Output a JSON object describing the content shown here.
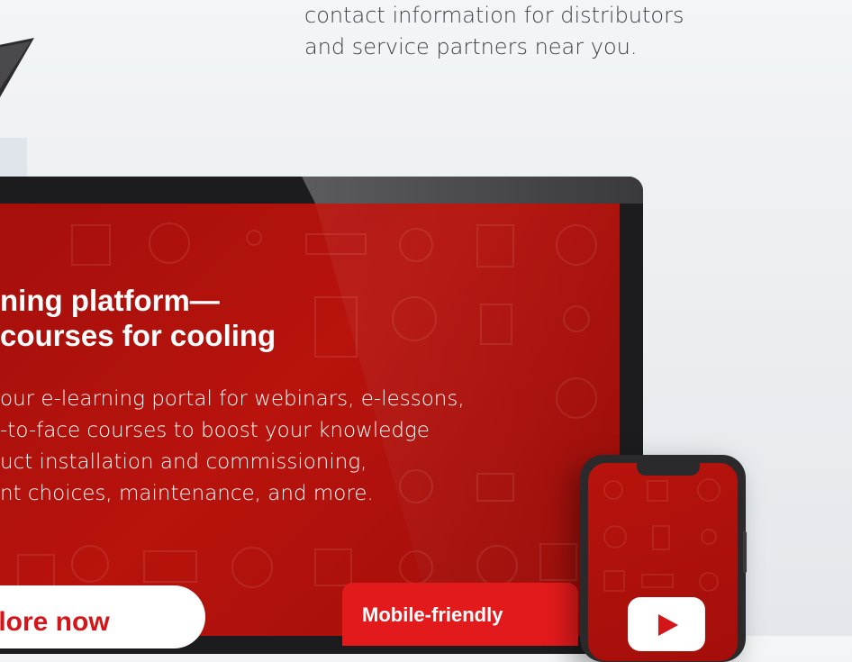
{
  "intro": {
    "lines": [
      "contact information for distributors",
      "and service partners near you."
    ]
  },
  "promo": {
    "headline_lines": [
      "ning platform—",
      "courses for cooling"
    ],
    "body_lines": [
      "our e-learning portal for webinars, e-lessons,",
      "-to-face courses to boost your knowledge",
      "uct installation and commissioning,",
      "nt choices, maintenance, and more."
    ],
    "cta_label": "plore now",
    "badge_label": "Mobile-friendly"
  },
  "colors": {
    "brand_red": "#e31a1c",
    "screen_red": "#b8130d",
    "cta_text": "#d4151a"
  },
  "icons": [
    "play-icon",
    "laptop-device",
    "phone-device"
  ]
}
